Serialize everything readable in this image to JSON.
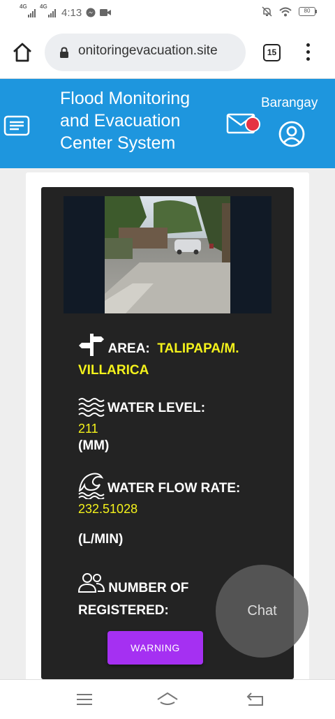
{
  "status_bar": {
    "net1": "4G",
    "net2": "4G",
    "time": "4:13",
    "battery": "80"
  },
  "browser": {
    "url": "onitoringevacuation.site",
    "tab_count": "15"
  },
  "header": {
    "title": "Flood Monitoring and Evacuation Center System",
    "account_label": "Barangay"
  },
  "station": {
    "area_label": "AREA:",
    "area_value": "TALIPAPA/M. VILLARICA",
    "water_level_label": "WATER LEVEL:",
    "water_level_value": "211",
    "water_level_unit": "(MM)",
    "flow_rate_label": "WATER FLOW RATE:",
    "flow_rate_value": "232.51028",
    "flow_rate_unit": "(L/MIN)",
    "registered_label": "NUMBER OF REGISTERED:",
    "warning_label": "WARNING"
  },
  "chat": {
    "label": "Chat"
  },
  "icons": {
    "sign": "signpost-icon",
    "water": "water-waves-icon",
    "wave": "tidal-wave-icon",
    "people": "people-icon"
  },
  "colors": {
    "header_blue": "#1e96de",
    "value_yellow": "#f4f21b",
    "warning_purple": "#a530f2",
    "notification_red": "#e53343"
  }
}
